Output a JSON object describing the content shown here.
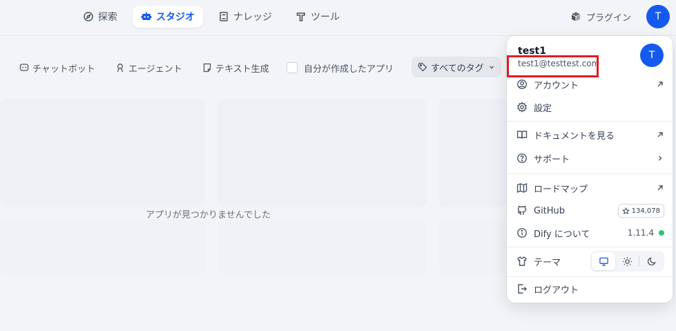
{
  "header": {
    "nav": [
      {
        "label": "探索",
        "icon": "compass-icon",
        "active": false
      },
      {
        "label": "スタジオ",
        "icon": "robot-icon",
        "active": true
      },
      {
        "label": "ナレッジ",
        "icon": "book-icon",
        "active": false
      },
      {
        "label": "ツール",
        "icon": "hammer-icon",
        "active": false
      }
    ],
    "plugins_label": "プラグイン",
    "avatar_initial": "T"
  },
  "filters": {
    "chatbot": "チャットボット",
    "agent": "エージェント",
    "text_gen": "テキスト生成",
    "created_by_me": "自分が作成したアプリ",
    "all_tags": "すべてのタグ"
  },
  "empty_state": "アプリが見つかりませんでした",
  "account_menu": {
    "name": "test1",
    "email": "test1@testtest.com",
    "avatar_initial": "T",
    "items": {
      "account": "アカウント",
      "settings": "設定",
      "docs": "ドキュメントを見る",
      "support": "サポート",
      "roadmap": "ロードマップ",
      "github": "GitHub",
      "github_stars": "134,078",
      "about": "Dify について",
      "version": "1.11.4",
      "theme": "テーマ",
      "logout": "ログアウト"
    }
  },
  "colors": {
    "accent": "#155aef",
    "highlight_box": "#e01b24",
    "status_ok": "#2cc56f"
  }
}
